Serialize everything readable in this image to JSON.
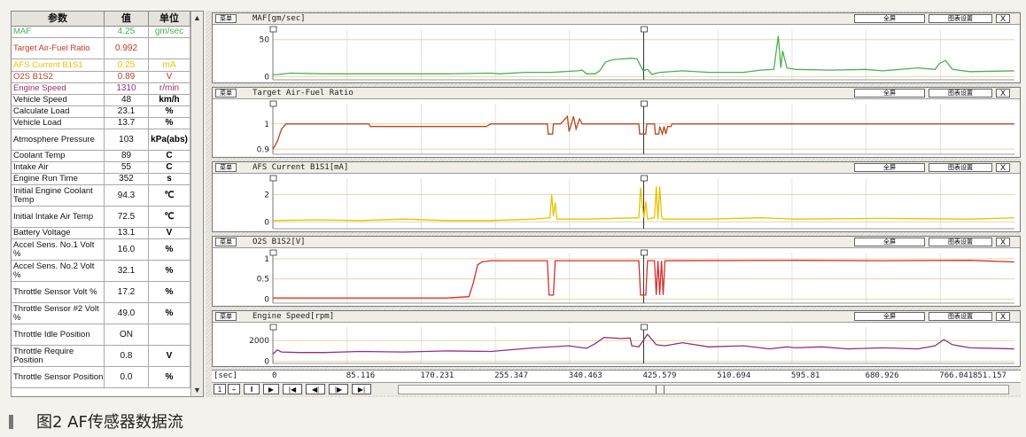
{
  "param_table": {
    "headers": [
      "参数",
      "值",
      "单位"
    ],
    "rows": [
      {
        "name": "MAF",
        "value": "4.25",
        "unit": "gm/sec",
        "color": "#4caf50",
        "h": 13
      },
      {
        "name": "Target Air-Fuel Ratio",
        "value": "0.992",
        "unit": "",
        "color": "#c0392b",
        "h": 24
      },
      {
        "name": "AFS Current B1S1",
        "value": "0.25",
        "unit": "mA",
        "color": "#e6c200",
        "h": 14
      },
      {
        "name": "O2S B1S2",
        "value": "0.89",
        "unit": "V",
        "color": "#c0392b",
        "h": 13
      },
      {
        "name": "Engine Speed",
        "value": "1310",
        "unit": "r/min",
        "color": "#9b2d6e",
        "h": 13
      },
      {
        "name": "Vehicle Speed",
        "value": "48",
        "unit": "km/h",
        "color": "#111111",
        "h": 13
      },
      {
        "name": "Calculate Load",
        "value": "23.1",
        "unit": "%",
        "color": "#111111",
        "h": 13
      },
      {
        "name": "Vehicle Load",
        "value": "13.7",
        "unit": "%",
        "color": "#111111",
        "h": 13
      },
      {
        "name": "Atmosphere Pressure",
        "value": "103",
        "unit": "kPa(abs)",
        "color": "#111111",
        "h": 24
      },
      {
        "name": "Coolant Temp",
        "value": "89",
        "unit": "C",
        "color": "#111111",
        "h": 13
      },
      {
        "name": "Intake Air",
        "value": "55",
        "unit": "C",
        "color": "#111111",
        "h": 13
      },
      {
        "name": "Engine Run Time",
        "value": "352",
        "unit": "s",
        "color": "#111111",
        "h": 13
      },
      {
        "name": "Initial Engine Coolant Temp",
        "value": "94.3",
        "unit": "℃",
        "color": "#111111",
        "h": 24
      },
      {
        "name": "Initial Intake Air Temp",
        "value": "72.5",
        "unit": "℃",
        "color": "#111111",
        "h": 24
      },
      {
        "name": "Battery Voltage",
        "value": "13.1",
        "unit": "V",
        "color": "#111111",
        "h": 13
      },
      {
        "name": "Accel Sens. No.1 Volt %",
        "value": "16.0",
        "unit": "%",
        "color": "#111111",
        "h": 24
      },
      {
        "name": "Accel Sens. No.2 Volt %",
        "value": "32.1",
        "unit": "%",
        "color": "#111111",
        "h": 24
      },
      {
        "name": "Throttle Sensor Volt %",
        "value": "17.2",
        "unit": "%",
        "color": "#111111",
        "h": 24
      },
      {
        "name": "Throttle Sensor #2 Volt %",
        "value": "49.0",
        "unit": "%",
        "color": "#111111",
        "h": 24
      },
      {
        "name": "Throttle Idle Position",
        "value": "ON",
        "unit": "",
        "color": "#111111",
        "h": 24
      },
      {
        "name": "Throttle Require Position",
        "value": "0.8",
        "unit": "V",
        "color": "#111111",
        "h": 24
      },
      {
        "name": "Throttle Sensor Position",
        "value": "0.0",
        "unit": "%",
        "color": "#111111",
        "h": 24
      }
    ]
  },
  "graph_buttons": {
    "select": "菜单",
    "fullscreen": "全屏",
    "settings": "图表设置",
    "close": "X"
  },
  "chart_data": [
    {
      "type": "line",
      "title": "MAF[gm/sec]",
      "series": [
        {
          "color": "#4caf50"
        }
      ],
      "ylim": [
        -4,
        64
      ],
      "yticks": [
        0,
        50
      ],
      "xlim": [
        0,
        851.157
      ],
      "x": [
        0,
        5,
        20,
        60,
        120,
        200,
        250,
        260,
        290,
        320,
        350,
        355,
        360,
        370,
        375,
        382,
        390,
        400,
        412,
        418,
        425,
        430,
        435,
        440,
        445,
        470,
        500,
        540,
        560,
        575,
        580,
        583,
        585,
        590,
        600,
        640,
        680,
        700,
        740,
        760,
        765,
        772,
        780,
        800,
        851
      ],
      "values": [
        3,
        3,
        5,
        4,
        4,
        4,
        5,
        4,
        6,
        6,
        8,
        9,
        4,
        4,
        8,
        20,
        23,
        24,
        25,
        24,
        8,
        10,
        3,
        5,
        6,
        8,
        6,
        6,
        9,
        10,
        55,
        12,
        35,
        12,
        10,
        9,
        10,
        8,
        12,
        10,
        18,
        22,
        10,
        7,
        8
      ]
    },
    {
      "type": "line",
      "title": "Target Air-Fuel Ratio",
      "series": [
        {
          "color": "#b8471e"
        }
      ],
      "ylim": [
        0.88,
        1.08
      ],
      "yticks": [
        0.9,
        1
      ],
      "xlim": [
        0,
        851.157
      ],
      "x": [
        0,
        5,
        10,
        15,
        20,
        110,
        112,
        245,
        250,
        300,
        315,
        316,
        321,
        322,
        330,
        338,
        340,
        345,
        348,
        352,
        355,
        356,
        420,
        421,
        428,
        429,
        438,
        439,
        443,
        444,
        447,
        449,
        451,
        453,
        457,
        458,
        600,
        851
      ],
      "values": [
        0.9,
        0.93,
        0.98,
        1.0,
        1.0,
        1.0,
        0.99,
        0.99,
        1.0,
        1.0,
        1.0,
        0.96,
        0.96,
        1.0,
        1.0,
        1.03,
        0.97,
        1.03,
        0.98,
        1.02,
        1.0,
        1.0,
        1.0,
        0.96,
        0.96,
        1.0,
        1.0,
        0.96,
        0.96,
        0.99,
        0.96,
        0.99,
        0.96,
        0.99,
        0.99,
        1.0,
        1.0,
        1.0
      ]
    },
    {
      "type": "line",
      "title": "AFS Current B1S1[mA]",
      "series": [
        {
          "color": "#e6c200"
        }
      ],
      "ylim": [
        -0.5,
        3.2
      ],
      "yticks": [
        0,
        2
      ],
      "xlim": [
        0,
        851.157
      ],
      "x": [
        0,
        50,
        100,
        150,
        200,
        250,
        300,
        318,
        320,
        322,
        324,
        326,
        360,
        420,
        422,
        424,
        426,
        428,
        430,
        438,
        440,
        442,
        444,
        446,
        448,
        500,
        560,
        600,
        700,
        800,
        851
      ],
      "values": [
        0.1,
        0.15,
        0.1,
        0.2,
        0.1,
        0.1,
        0.2,
        0.3,
        2.0,
        0.4,
        1.4,
        0.2,
        0.2,
        0.3,
        2.5,
        1.2,
        0.3,
        1.5,
        0.2,
        0.3,
        2.6,
        0.2,
        2.6,
        0.4,
        0.2,
        0.2,
        0.3,
        0.2,
        0.25,
        0.2,
        0.3
      ]
    },
    {
      "type": "line",
      "title": "O2S B1S2[V]",
      "series": [
        {
          "color": "#d32f2f"
        }
      ],
      "ylim": [
        -0.1,
        1.15
      ],
      "yticks": [
        0,
        0.5,
        1
      ],
      "xlim": [
        0,
        851.157
      ],
      "x": [
        0,
        100,
        200,
        225,
        230,
        235,
        240,
        250,
        300,
        315,
        317,
        322,
        324,
        360,
        420,
        422,
        428,
        430,
        438,
        440,
        442,
        444,
        446,
        448,
        450,
        452,
        600,
        700,
        800,
        851
      ],
      "values": [
        0.03,
        0.03,
        0.03,
        0.06,
        0.4,
        0.85,
        0.92,
        0.95,
        0.95,
        0.95,
        0.1,
        0.1,
        0.95,
        0.95,
        0.95,
        0.1,
        0.1,
        0.95,
        0.95,
        0.1,
        0.95,
        0.1,
        0.95,
        0.1,
        0.95,
        0.95,
        0.96,
        0.95,
        0.96,
        0.92
      ]
    },
    {
      "type": "line",
      "title": "Engine Speed[rpm]",
      "series": [
        {
          "color": "#9b2d6e"
        }
      ],
      "ylim": [
        -200,
        3300
      ],
      "yticks": [
        0,
        2000
      ],
      "xlim": [
        0,
        851.157
      ],
      "x": [
        0,
        5,
        10,
        30,
        60,
        100,
        150,
        200,
        250,
        300,
        340,
        360,
        370,
        380,
        400,
        410,
        412,
        420,
        430,
        440,
        450,
        470,
        500,
        540,
        560,
        570,
        590,
        600,
        630,
        660,
        700,
        740,
        760,
        770,
        780,
        800,
        851
      ],
      "values": [
        700,
        1100,
        900,
        850,
        850,
        950,
        900,
        1000,
        950,
        1300,
        1500,
        1250,
        1700,
        2300,
        2200,
        2250,
        1500,
        1400,
        2600,
        1600,
        1500,
        1800,
        1400,
        1500,
        1300,
        1200,
        1400,
        1300,
        1400,
        1200,
        1300,
        1200,
        1500,
        2100,
        1600,
        1300,
        1200
      ]
    }
  ],
  "time_axis": {
    "unit_label": "[sec]",
    "ticks": [
      "0",
      "85.116",
      "170.231",
      "255.347",
      "340.463",
      "425.579",
      "510.694",
      "595.81",
      "680.926",
      "766.041",
      "851.157"
    ],
    "cursor_position": 425.579
  },
  "controls": {
    "page": "1",
    "spin": "÷",
    "pause": "‖",
    "play": "▶",
    "step_back": "|◀",
    "rewind": "◀|",
    "step_fwd": "|▶",
    "end": "▶|"
  },
  "caption": "图2   AF传感器数据流"
}
